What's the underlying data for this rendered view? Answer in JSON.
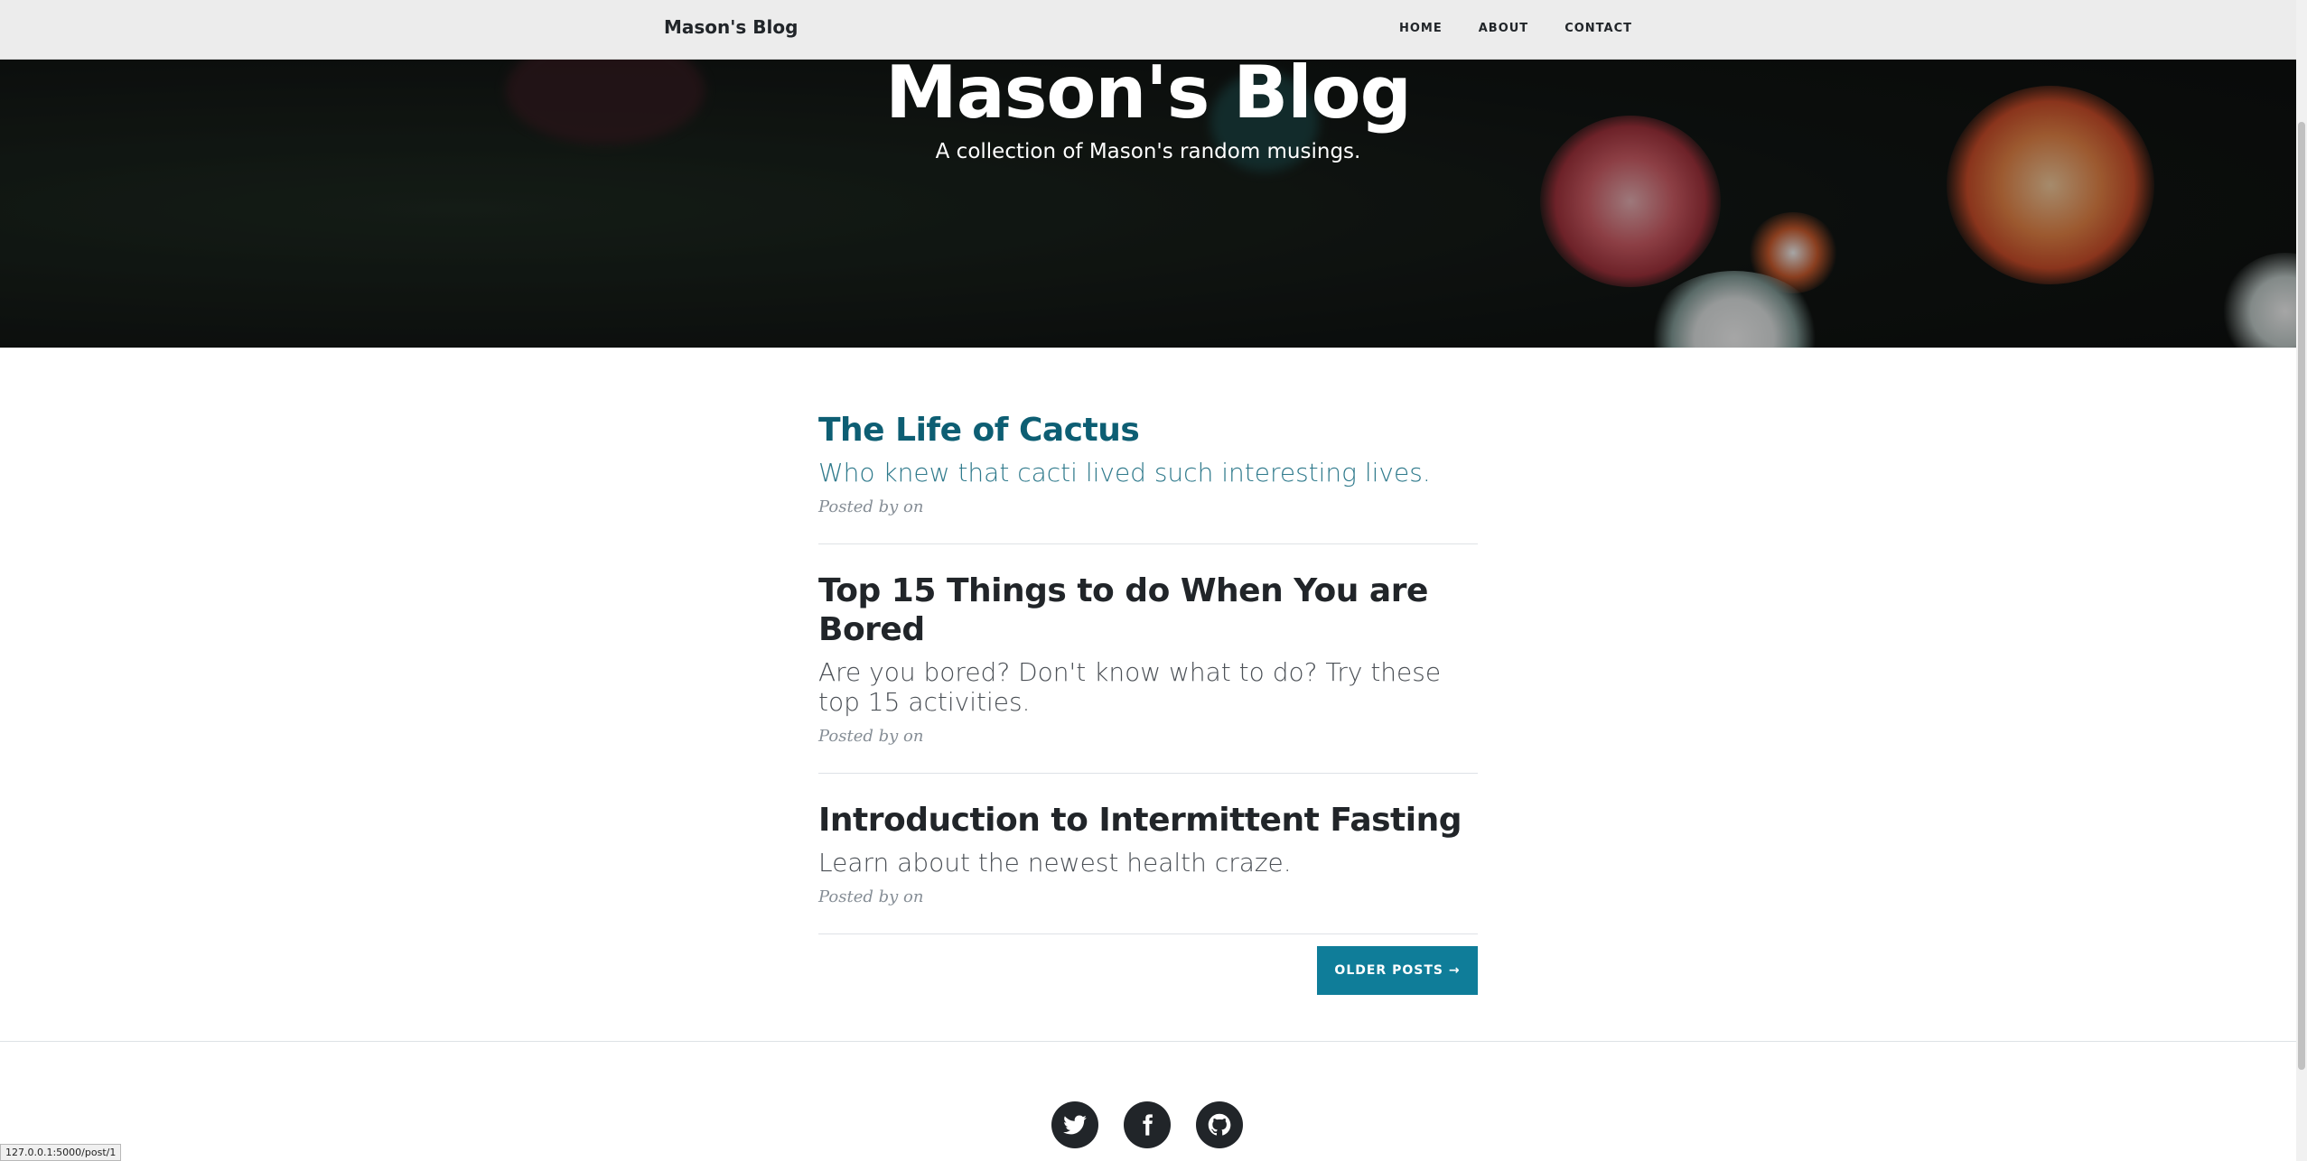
{
  "nav": {
    "brand": "Mason's Blog",
    "links": [
      "HOME",
      "ABOUT",
      "CONTACT"
    ]
  },
  "masthead": {
    "title": "Mason's Blog",
    "subtitle": "A collection of Mason's random musings."
  },
  "posts": [
    {
      "title": "The Life of Cactus",
      "subtitle": "Who knew that cacti lived such interesting lives.",
      "meta": "Posted by on"
    },
    {
      "title": "Top 15 Things to do When You are Bored",
      "subtitle": "Are you bored? Don't know what to do? Try these top 15 activities.",
      "meta": "Posted by on"
    },
    {
      "title": "Introduction to Intermittent Fasting",
      "subtitle": "Learn about the newest health craze.",
      "meta": "Posted by on"
    }
  ],
  "pager": {
    "older_label": "OLDER POSTS →"
  },
  "footer": {
    "social": [
      "twitter-icon",
      "facebook-icon",
      "github-icon"
    ]
  },
  "status": {
    "url": "127.0.0.1:5000/post/1"
  },
  "colors": {
    "accent": "#0f7d99",
    "link_hover": "#0d5e73",
    "dark": "#212529"
  }
}
